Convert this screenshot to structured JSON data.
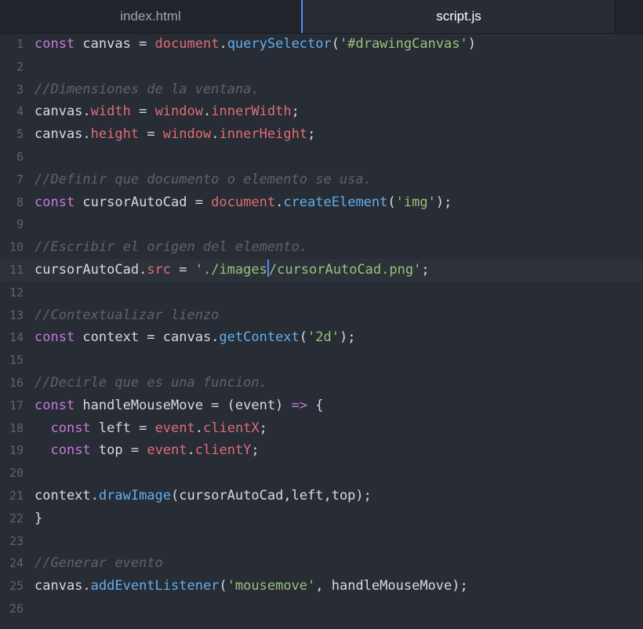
{
  "tabs": [
    {
      "label": "index.html",
      "active": false
    },
    {
      "label": "script.js",
      "active": true
    }
  ],
  "colors": {
    "background": "#282c34",
    "keyword": "#c678dd",
    "object": "#e06c75",
    "function": "#61afef",
    "string": "#98c379",
    "comment": "#5c6370",
    "tab_accent": "#568af2"
  },
  "editor": {
    "current_line": 11,
    "lines": [
      {
        "n": "1",
        "t": [
          [
            "kw",
            "const"
          ],
          [
            "pl",
            " canvas = "
          ],
          [
            "obj",
            "document"
          ],
          [
            "pl",
            "."
          ],
          [
            "fn",
            "querySelector"
          ],
          [
            "pl",
            "("
          ],
          [
            "str",
            "'#drawingCanvas'"
          ],
          [
            "pl",
            ")"
          ]
        ]
      },
      {
        "n": "2",
        "t": []
      },
      {
        "n": "3",
        "t": [
          [
            "com",
            "//Dimensiones de la ventana."
          ]
        ]
      },
      {
        "n": "4",
        "t": [
          [
            "pl",
            "canvas."
          ],
          [
            "obj",
            "width"
          ],
          [
            "pl",
            " = "
          ],
          [
            "obj",
            "window"
          ],
          [
            "pl",
            "."
          ],
          [
            "obj",
            "innerWidth"
          ],
          [
            "pl",
            ";"
          ]
        ]
      },
      {
        "n": "5",
        "t": [
          [
            "pl",
            "canvas."
          ],
          [
            "obj",
            "height"
          ],
          [
            "pl",
            " = "
          ],
          [
            "obj",
            "window"
          ],
          [
            "pl",
            "."
          ],
          [
            "obj",
            "innerHeight"
          ],
          [
            "pl",
            ";"
          ]
        ]
      },
      {
        "n": "6",
        "t": []
      },
      {
        "n": "7",
        "t": [
          [
            "com",
            "//Definir que documento o elemento se usa."
          ]
        ]
      },
      {
        "n": "8",
        "t": [
          [
            "kw",
            "const"
          ],
          [
            "pl",
            " cursorAutoCad = "
          ],
          [
            "obj",
            "document"
          ],
          [
            "pl",
            "."
          ],
          [
            "fn",
            "createElement"
          ],
          [
            "pl",
            "("
          ],
          [
            "str",
            "'img'"
          ],
          [
            "pl",
            ");"
          ]
        ]
      },
      {
        "n": "9",
        "t": []
      },
      {
        "n": "10",
        "t": [
          [
            "com",
            "//Escribir el origen del elemento."
          ]
        ]
      },
      {
        "n": "11",
        "t": [
          [
            "pl",
            "cursorAutoCad."
          ],
          [
            "obj",
            "src"
          ],
          [
            "pl",
            " = "
          ],
          [
            "str",
            "'./images"
          ],
          [
            "caret",
            ""
          ],
          [
            "str",
            "/cursorAutoCad.png'"
          ],
          [
            "pl",
            ";"
          ]
        ]
      },
      {
        "n": "12",
        "t": []
      },
      {
        "n": "13",
        "t": [
          [
            "com",
            "//Contextualizar lienzo"
          ]
        ]
      },
      {
        "n": "14",
        "t": [
          [
            "kw",
            "const"
          ],
          [
            "pl",
            " context = canvas."
          ],
          [
            "fn",
            "getContext"
          ],
          [
            "pl",
            "("
          ],
          [
            "str",
            "'2d'"
          ],
          [
            "pl",
            ");"
          ]
        ]
      },
      {
        "n": "15",
        "t": []
      },
      {
        "n": "16",
        "t": [
          [
            "com",
            "//Decirle que es una funcion."
          ]
        ]
      },
      {
        "n": "17",
        "t": [
          [
            "kw",
            "const"
          ],
          [
            "pl",
            " handleMouseMove = (event) "
          ],
          [
            "kw",
            "=>"
          ],
          [
            "pl",
            " {"
          ]
        ]
      },
      {
        "n": "18",
        "t": [
          [
            "pl",
            "  "
          ],
          [
            "kw",
            "const"
          ],
          [
            "pl",
            " left = "
          ],
          [
            "obj",
            "event"
          ],
          [
            "pl",
            "."
          ],
          [
            "obj",
            "clientX"
          ],
          [
            "pl",
            ";"
          ]
        ]
      },
      {
        "n": "19",
        "t": [
          [
            "pl",
            "  "
          ],
          [
            "kw",
            "const"
          ],
          [
            "pl",
            " top = "
          ],
          [
            "obj",
            "event"
          ],
          [
            "pl",
            "."
          ],
          [
            "obj",
            "clientY"
          ],
          [
            "pl",
            ";"
          ]
        ]
      },
      {
        "n": "20",
        "t": []
      },
      {
        "n": "21",
        "t": [
          [
            "pl",
            "context."
          ],
          [
            "fn",
            "drawImage"
          ],
          [
            "pl",
            "(cursorAutoCad,left,top);"
          ]
        ]
      },
      {
        "n": "22",
        "t": [
          [
            "pl",
            "}"
          ]
        ]
      },
      {
        "n": "23",
        "t": []
      },
      {
        "n": "24",
        "t": [
          [
            "com",
            "//Generar evento"
          ]
        ]
      },
      {
        "n": "25",
        "t": [
          [
            "pl",
            "canvas."
          ],
          [
            "fn",
            "addEventListener"
          ],
          [
            "pl",
            "("
          ],
          [
            "str",
            "'mousemove'"
          ],
          [
            "pl",
            ", handleMouseMove);"
          ]
        ]
      },
      {
        "n": "26",
        "t": []
      }
    ]
  }
}
